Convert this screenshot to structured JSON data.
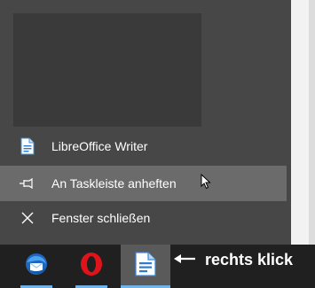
{
  "jumplist": {
    "app_item": {
      "label": "LibreOffice Writer",
      "icon": "libreoffice-writer-icon"
    },
    "pin_item": {
      "label": "An Taskleiste anheften",
      "icon": "pin-icon"
    },
    "close_item": {
      "label": "Fenster schließen",
      "icon": "close-icon"
    }
  },
  "taskbar": {
    "buttons": [
      {
        "name": "Thunderbird",
        "icon": "thunderbird-icon"
      },
      {
        "name": "Opera",
        "icon": "opera-icon"
      },
      {
        "name": "LibreOffice Writer",
        "icon": "libreoffice-writer-icon",
        "active": true
      }
    ]
  },
  "annotation": {
    "text": "rechts klick"
  },
  "colors": {
    "jumplist_bg": "#474747",
    "hover_bg": "#6b6b6b",
    "taskbar_bg": "#202020",
    "accent": "#6fb3e8"
  }
}
